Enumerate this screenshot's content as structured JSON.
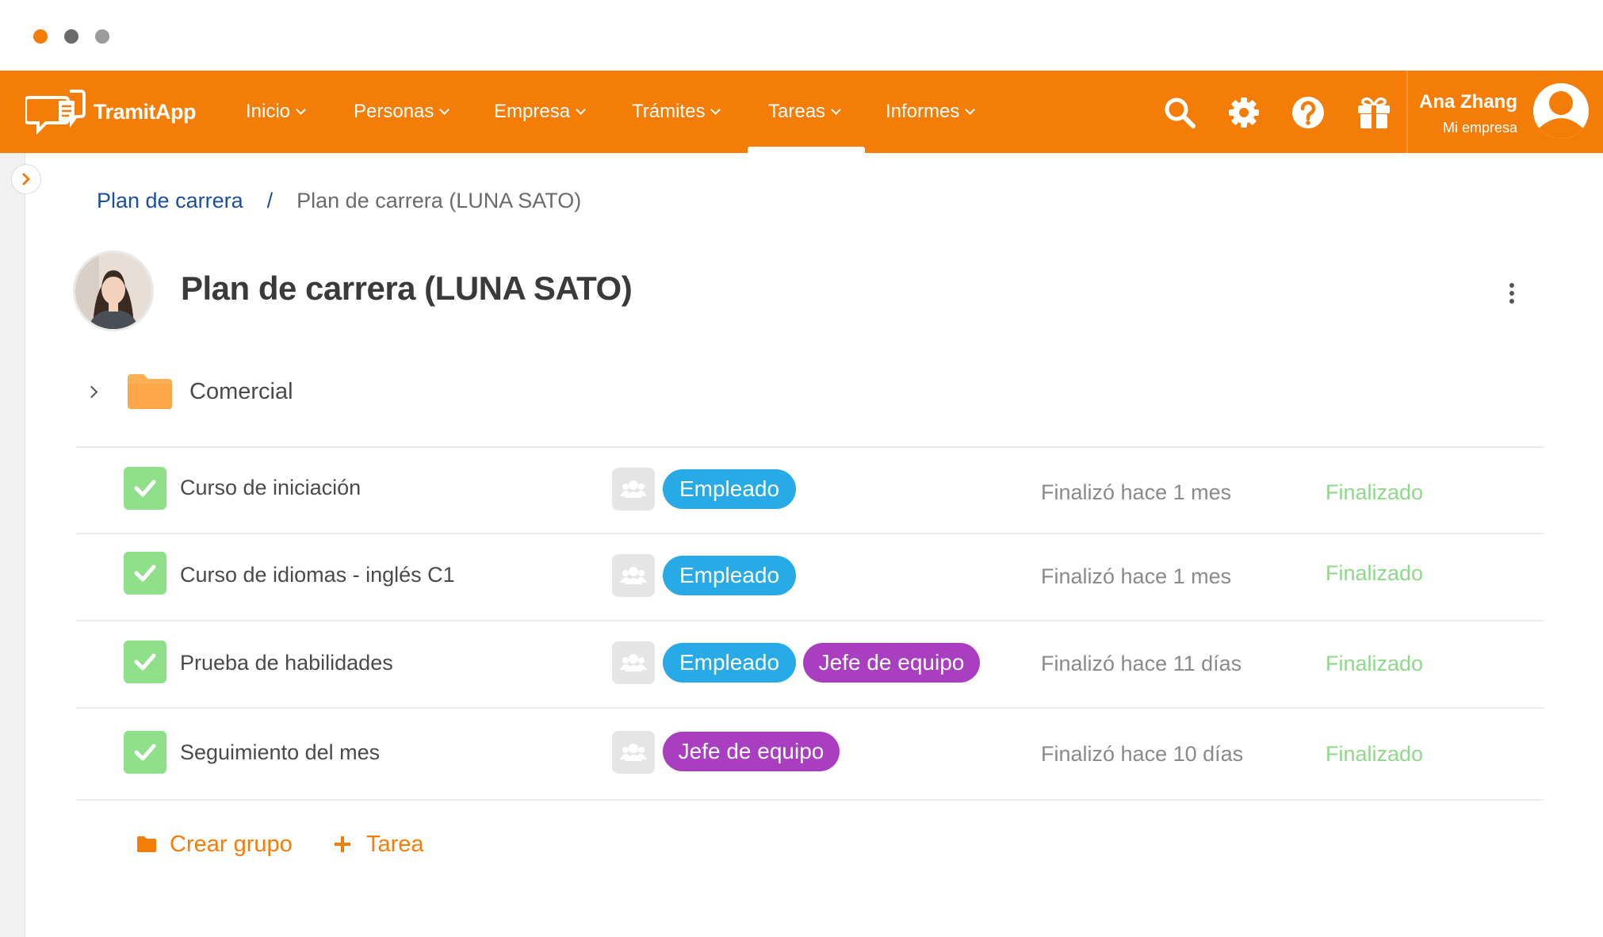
{
  "window": {
    "dots": [
      {
        "name": "close",
        "color": "#f47d08"
      },
      {
        "name": "minimize",
        "color": "#6b6b6b"
      },
      {
        "name": "maximize",
        "color": "#9b9b9b"
      }
    ]
  },
  "brand": {
    "logo_text": "TramitApp",
    "accent_color": "#f47d08"
  },
  "nav": {
    "items": [
      {
        "label": "Inicio"
      },
      {
        "label": "Personas"
      },
      {
        "label": "Empresa"
      },
      {
        "label": "Trámites"
      },
      {
        "label": "Tareas",
        "active": true
      },
      {
        "label": "Informes"
      }
    ],
    "icons": [
      "search-icon",
      "gear-icon",
      "help-icon",
      "gift-icon"
    ]
  },
  "user": {
    "name": "Ana Zhang",
    "company": "Mi empresa"
  },
  "breadcrumb": {
    "parent": "Plan de carrera",
    "separator": "/",
    "current": "Plan de carrera (LUNA SATO)"
  },
  "page": {
    "title": "Plan de carrera (LUNA SATO)"
  },
  "group": {
    "label": "Comercial"
  },
  "tasks": [
    {
      "name": "Curso de iniciación",
      "badges": [
        {
          "label": "Empleado",
          "type": "emp"
        }
      ],
      "finished": "Finalizó hace 1 mes",
      "status": "Finalizado"
    },
    {
      "name": "Curso de idiomas - inglés C1",
      "badges": [
        {
          "label": "Empleado",
          "type": "emp"
        }
      ],
      "finished": "Finalizó hace 1 mes",
      "status": "Finalizado"
    },
    {
      "name": "Prueba de habilidades",
      "badges": [
        {
          "label": "Empleado",
          "type": "emp"
        },
        {
          "label": "Jefe de equipo",
          "type": "jefe"
        }
      ],
      "finished": "Finalizó hace 11 días",
      "status": "Finalizado"
    },
    {
      "name": "Seguimiento del mes",
      "badges": [
        {
          "label": "Jefe de equipo",
          "type": "jefe"
        }
      ],
      "finished": "Finalizó hace 10 días",
      "status": "Finalizado"
    }
  ],
  "actions": {
    "create_group": "Crear grupo",
    "add_task": "Tarea"
  },
  "colors": {
    "badge_empleado": "#27aae6",
    "badge_jefe": "#a93fc0",
    "status_done": "#8fd88a",
    "check_done": "#8fdf8b"
  }
}
